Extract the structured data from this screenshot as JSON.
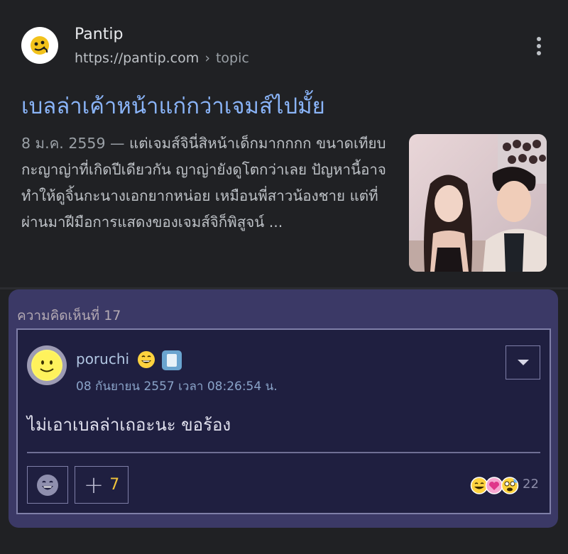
{
  "result": {
    "site_name": "Pantip",
    "site_url": "https://pantip.com",
    "breadcrumb_sep": "›",
    "breadcrumb": "topic",
    "title": "เบลล่าเค้าหน้าแก่กว่าเจมส์ไปมั้ย",
    "snippet_date": "8 ม.ค. 2559 —",
    "snippet_text": " แต่เจมส์จินี่สิหน้าเด็กมากกกก ขนาดเทียบกะญาญ่าที่เกิดปีเดียวกัน ญาญ่ายังดูโตกว่าเลย ปัญหานี้อาจทำให้ดูจิ้นกะนางเอกยากหน่อย เหมือนพี่สาวน้องชาย แต่ที่ผ่านมาฝีมือการแสดงของเจมส์จิก็พิสูจน์ ..."
  },
  "comment": {
    "number_label": "ความคิดเห็นที่ 17",
    "username": "poruchi",
    "timestamp": "08 กันยายน 2557 เวลา 08:26:54 น.",
    "text": "ไม่เอาเบลล่าเถอะนะ ขอร้อง",
    "plus_count": "7",
    "reaction_count": "22"
  },
  "colors": {
    "link_blue": "#8ab4f8",
    "card_purple": "#3b3966",
    "inner_navy": "#1f1f40",
    "plus_yellow": "#f0c43a"
  },
  "icons": [
    "pantip-logo-icon",
    "more-vert-icon",
    "smiley-avatar-icon",
    "grin-emoji-icon",
    "badge-icon",
    "chevron-down-icon",
    "emotion-icon",
    "plus-icon",
    "reaction-icons"
  ]
}
